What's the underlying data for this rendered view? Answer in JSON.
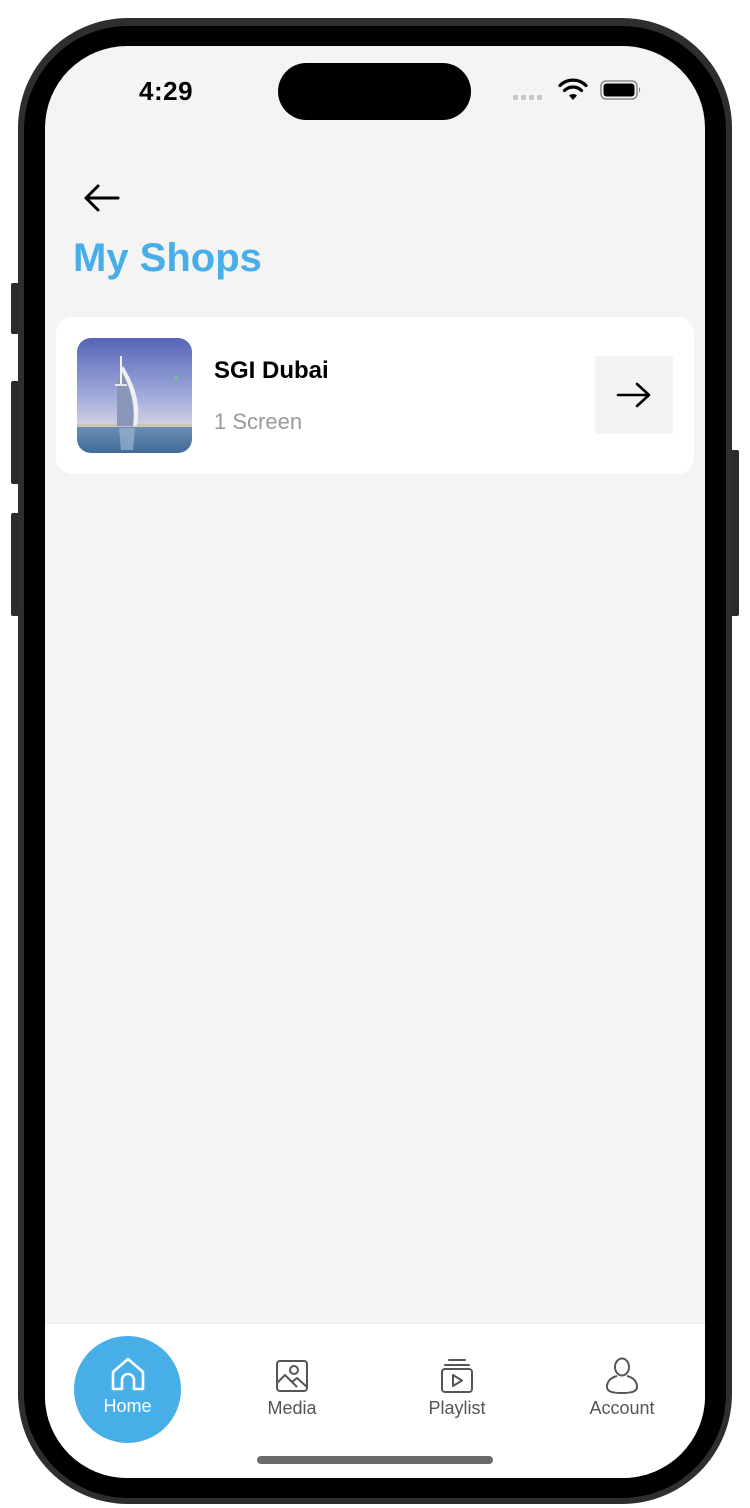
{
  "status_bar": {
    "time": "4:29",
    "signal_icon": "cellular-signal-icon",
    "wifi_icon": "wifi-icon",
    "battery_icon": "battery-icon"
  },
  "header": {
    "back_icon": "arrow-left-icon",
    "title": "My Shops"
  },
  "colors": {
    "accent": "#47aee8",
    "background": "#f4f4f4",
    "card": "#ffffff",
    "muted_text": "#9a9a9a"
  },
  "shops": [
    {
      "name": "SGI Dubai",
      "subtitle": "1 Screen",
      "thumbnail": "burj-al-arab-photo",
      "action_icon": "arrow-right-icon"
    }
  ],
  "tab_bar": {
    "active": "Home",
    "items": [
      {
        "label": "Home",
        "icon": "home-icon"
      },
      {
        "label": "Media",
        "icon": "image-icon"
      },
      {
        "label": "Playlist",
        "icon": "playlist-icon"
      },
      {
        "label": "Account",
        "icon": "user-icon"
      }
    ]
  }
}
